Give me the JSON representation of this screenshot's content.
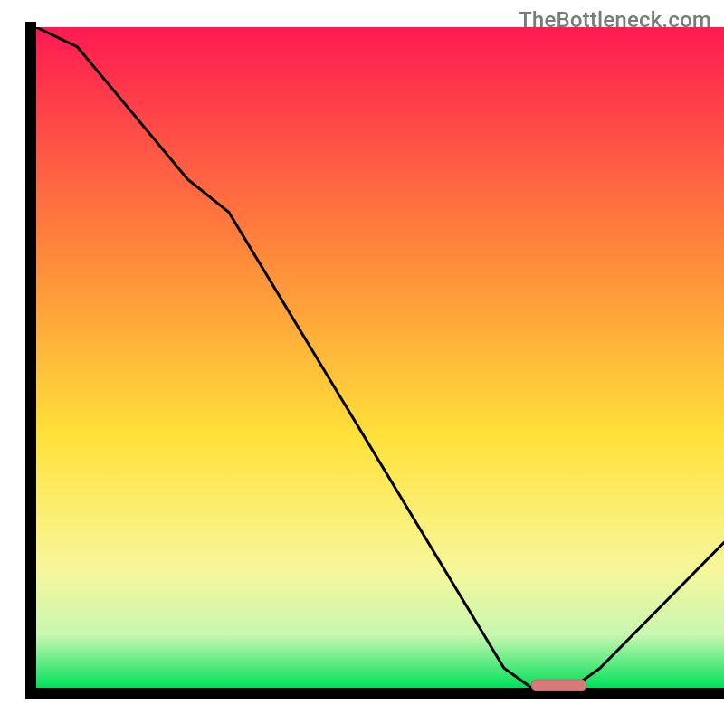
{
  "watermark": "TheBottleneck.com",
  "colors": {
    "axis": "#000000",
    "curve": "#000000",
    "marker_fill": "#d77a7a",
    "marker_stroke": "#c46666",
    "gradient_top": "#ff1a52",
    "gradient_mid_upper": "#ff8a3a",
    "gradient_mid": "#ffe13a",
    "gradient_lower": "#f7f79a",
    "gradient_band": "#c8f7b0",
    "gradient_bottom": "#00e05a"
  },
  "chart_data": {
    "type": "line",
    "title": "",
    "xlabel": "",
    "ylabel": "",
    "xlim": [
      0,
      100
    ],
    "ylim": [
      0,
      100
    ],
    "grid": false,
    "legend": false,
    "annotations": [
      "TheBottleneck.com"
    ],
    "x": [
      0,
      6,
      22,
      28,
      68,
      72,
      78,
      82,
      100
    ],
    "values": [
      100,
      97,
      77,
      72,
      3,
      0,
      0,
      3,
      22
    ],
    "optimal_band": {
      "x_start": 72,
      "x_end": 80,
      "y": 0
    },
    "notes": "Bottleneck-style curve: descends from top-left, flattens near x≈72–80 at y≈0 (optimal zone, pink marker), then rises toward the right edge. Background is a vertical red→orange→yellow→pale→green gradient. Values are read off relative to the plot area (0–100 on each axis) and rounded to whole numbers."
  }
}
